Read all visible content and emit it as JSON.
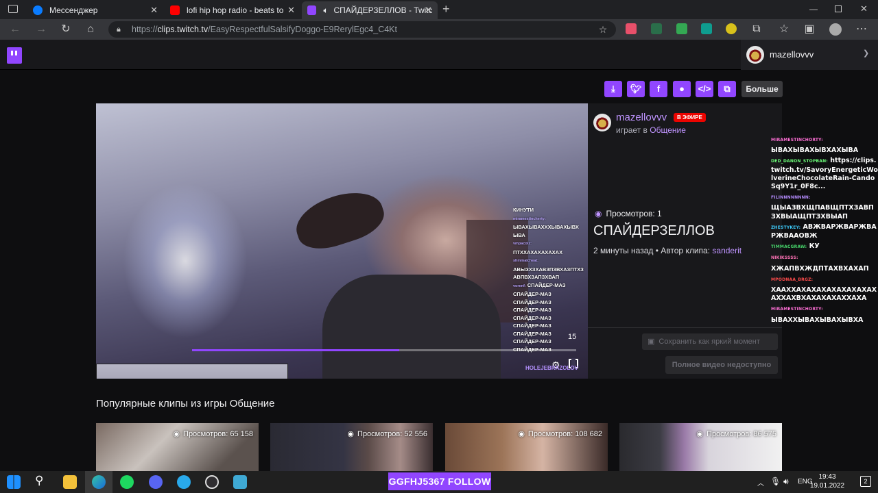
{
  "browser": {
    "tabs": [
      {
        "title": "Мессенджер",
        "favicon_color": "#0a7cff"
      },
      {
        "title": "lofi hip hop radio - beats to relax",
        "favicon_color": "#ff0000"
      },
      {
        "title": "СПАЙДЕРЗЕЛЛОВ - Twitch",
        "favicon_color": "#9146ff",
        "active": true
      }
    ],
    "new_tab_label": "+",
    "url_scheme": "https://",
    "url_host": "clips.twitch.tv",
    "url_path": "/EasyRespectfulSalsifyDoggo-E9RerylEgc4_C4Kt",
    "icons": [
      "back-icon",
      "forward-icon",
      "reload-icon",
      "home-icon",
      "lock-icon",
      "favorite-icon",
      "extensions-icon",
      "collections-icon",
      "profile-icon",
      "more-icon"
    ]
  },
  "twitch": {
    "username": "mazellovvv",
    "brand_color": "#9146ff",
    "share": {
      "buttons": [
        "download",
        "twitter",
        "facebook",
        "reddit",
        "embed",
        "copy"
      ],
      "more_label": "Больше"
    },
    "clip": {
      "channel": "mazellovvv",
      "live_badge": "В ЭФИРЕ",
      "playing_prefix": "играет в",
      "game": "Общение",
      "views_label": "Просмотров: 1",
      "title": "СПАЙДЕРЗЕЛЛОВ",
      "age": "2 минуты назад",
      "author_prefix": "Автор клипа:",
      "author": "sanderit",
      "save_bright_label": "Сохранить как яркий момент",
      "full_video_label": "Полное видео недоступно",
      "timer": "15",
      "watermark": "HOLEJEBRAZOLOV",
      "progress": 0.54
    },
    "video_chat": [
      {
        "name": "",
        "text": "КИНУТИ"
      },
      {
        "name": "miramestincherty:",
        "text": ""
      },
      {
        "name": "",
        "text": "ЫВАХЫВАХХХЫВАХЫВХ"
      },
      {
        "name": "",
        "text": "ЫВА"
      },
      {
        "name": "vmpacolz:",
        "text": ""
      },
      {
        "name": "",
        "text": "ПТХХАХАХАХАХАХ"
      },
      {
        "name": "shmmalcheat:",
        "text": ""
      },
      {
        "name": "",
        "text": "АВЫЗХЗХАВЗПЗВХАЗПТХЗ"
      },
      {
        "name": "",
        "text": "АВПВХЗАПЗХВАП"
      },
      {
        "name": "vorenf:",
        "text": "СПАЙДЕР-МАЗ"
      },
      {
        "name": "",
        "text": "СПАЙДЕР-МАЗ"
      },
      {
        "name": "",
        "text": "СПАЙДЕР-МАЗ"
      },
      {
        "name": "",
        "text": "СПАЙДЕР-МАЗ"
      },
      {
        "name": "",
        "text": "СПАЙДЕР-МАЗ"
      },
      {
        "name": "",
        "text": "СПАЙДЕР-МАЗ"
      },
      {
        "name": "",
        "text": "СПАЙДЕР-МАЗ"
      },
      {
        "name": "",
        "text": "СПАЙДЕР-МАЗ"
      },
      {
        "name": "",
        "text": "СПАЙДЕР-МАЗ"
      }
    ],
    "side_chat": [
      {
        "name": "MIRAMESTINCHORTY:",
        "color": "#ff6fd6",
        "text": ""
      },
      {
        "name": "",
        "color": "#ffffff",
        "text": "ЫВАХЫВАХЫВХАХЫВА"
      },
      {
        "name": "DED_DANON_STOPBAN:",
        "color": "#6dff7a",
        "text": "https://clips.twitch.tv/SavoryEnergeticWolverineChocolateRain-CandoSq9Y1r_0F8c..."
      },
      {
        "name": "FILINNNNNNNN:",
        "color": "#b58cff",
        "text": ""
      },
      {
        "name": "",
        "color": "#ffffff",
        "text": "ЩЫАЗВХЩПАВЩПТХЗАВПЗХВЫАЩПТЗХВЫАП"
      },
      {
        "name": "ZHESTYKEY:",
        "color": "#3ecfff",
        "text": "АВЖВАРЖВАРЖВАРЖВААОВЖ"
      },
      {
        "name": "TIMMACGRAW:",
        "color": "#46d36a",
        "text": "КУ"
      },
      {
        "name": "NIKIKSSSS:",
        "color": "#ff72b6",
        "text": ""
      },
      {
        "name": "",
        "color": "#ffffff",
        "text": "ХЖАПВХЖДПТАХВХАХАП"
      },
      {
        "name": "MPODNAA_BRGZ:",
        "color": "#ff4b4b",
        "text": ""
      },
      {
        "name": "",
        "color": "#ffffff",
        "text": "ХААХХАХАХАХАХАХАХАХАХАХХАХВХАХАХАХАХХАХА"
      },
      {
        "name": "MIRAMESTINCHORTY:",
        "color": "#ff6fd6",
        "text": ""
      },
      {
        "name": "",
        "color": "#ffffff",
        "text": "ЫВАХХЫВАХЫВАХЫВХА"
      }
    ],
    "popular": {
      "title": "Популярные клипы из игры Общение",
      "clips": [
        {
          "views": "Просмотров: 65 158"
        },
        {
          "views": "Просмотров: 52 556"
        },
        {
          "views": "Просмотров: 108 682"
        },
        {
          "views": "Просмотров: 86 575"
        }
      ]
    }
  },
  "taskbar": {
    "follow_banner": "GGFHJ5367  FOLLOW",
    "language": "ENG",
    "time": "19:43",
    "date": "19.01.2022",
    "notification_count": "2",
    "apps": [
      "start-icon",
      "search-icon",
      "file-explorer-icon",
      "edge-icon",
      "spotify-icon",
      "discord-icon",
      "telegram-icon",
      "obs-icon",
      "app-icon"
    ]
  }
}
